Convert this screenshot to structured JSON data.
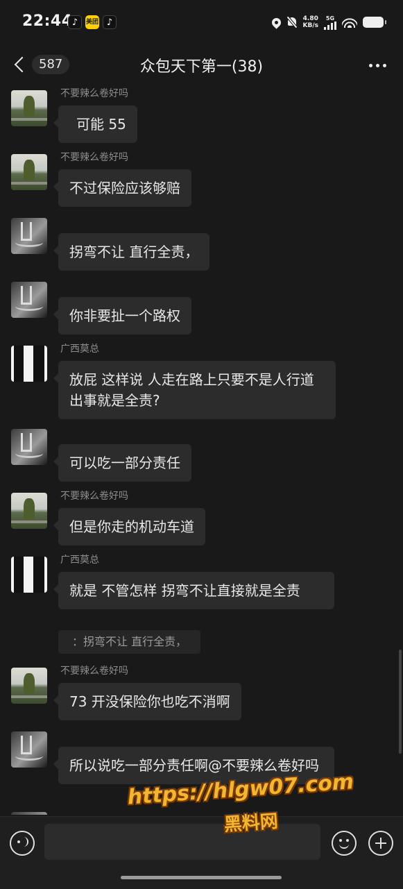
{
  "status_bar": {
    "time": "22:44",
    "app_icons": [
      "tiktok-icon",
      "meituan-icon",
      "tiktok-icon"
    ],
    "meituan_label": "美团",
    "speed_value": "4.80",
    "speed_unit": "KB/s",
    "network": "5G"
  },
  "header": {
    "unread_count": "587",
    "title": "众包天下第一(38)"
  },
  "messages": [
    {
      "sender": "不要辣么卷好吗",
      "text": "可能 55"
    },
    {
      "sender": "不要辣么卷好吗",
      "text": "不过保险应该够赔"
    },
    {
      "sender": "",
      "text": "拐弯不让 直行全责，"
    },
    {
      "sender": "",
      "text": "你非要扯一个路权"
    },
    {
      "sender": "广西莫总",
      "text": "放屁  这样说  人走在路上只要不是人行道出事就是全责?"
    },
    {
      "sender": "",
      "text": "可以吃一部分责任"
    },
    {
      "sender": "不要辣么卷好吗",
      "text": "但是你走的机动车道"
    },
    {
      "sender": "广西莫总",
      "text": "就是  不管怎样  拐弯不让直接就是全责",
      "quote": "：拐弯不让 直行全责，"
    },
    {
      "sender": "不要辣么卷好吗",
      "text": "73 开没保险你也吃不消啊"
    },
    {
      "sender": "",
      "text": "所以说吃一部分责任啊@不要辣么卷好吗"
    }
  ],
  "input": {
    "placeholder": ""
  },
  "watermark": {
    "url": "https://hlgw07.com",
    "label": "黑料网"
  }
}
